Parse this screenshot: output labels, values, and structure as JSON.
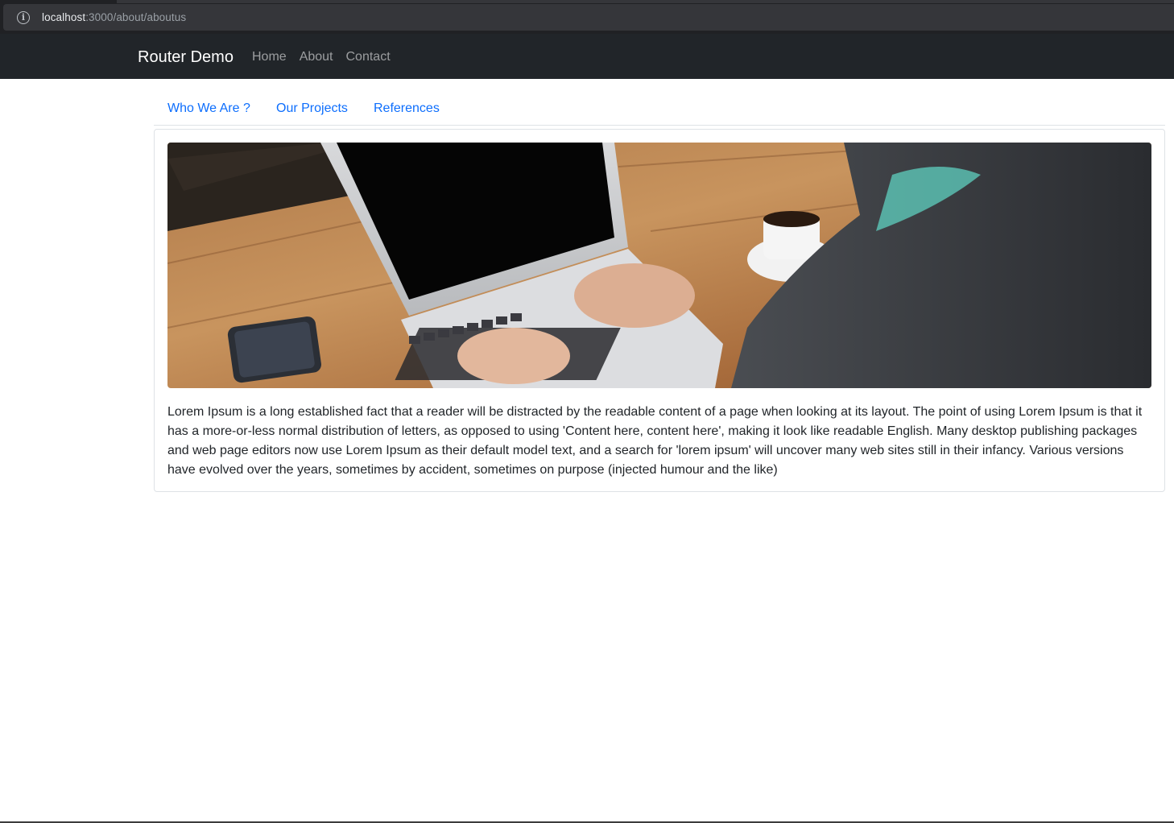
{
  "browser": {
    "url_host": "localhost",
    "url_rest": ":3000/about/aboutus"
  },
  "navbar": {
    "brand": "Router Demo",
    "links": [
      "Home",
      "About",
      "Contact"
    ]
  },
  "tabs": [
    "Who We Are ?",
    "Our Projects",
    "References"
  ],
  "card": {
    "image_alt": "laptop-on-wooden-desk-photo",
    "text": "Lorem Ipsum is a long established fact that a reader will be distracted by the readable content of a page when looking at its layout. The point of using Lorem Ipsum is that it has a more-or-less normal distribution of letters, as opposed to using 'Content here, content here', making it look like readable English. Many desktop publishing packages and web page editors now use Lorem Ipsum as their default model text, and a search for 'lorem ipsum' will uncover many web sites still in their infancy. Various versions have evolved over the years, sometimes by accident, sometimes on purpose (injected humour and the like)"
  },
  "colors": {
    "navbar_bg": "#212529",
    "link_blue": "#0d6efd",
    "browser_bg": "#202124"
  }
}
